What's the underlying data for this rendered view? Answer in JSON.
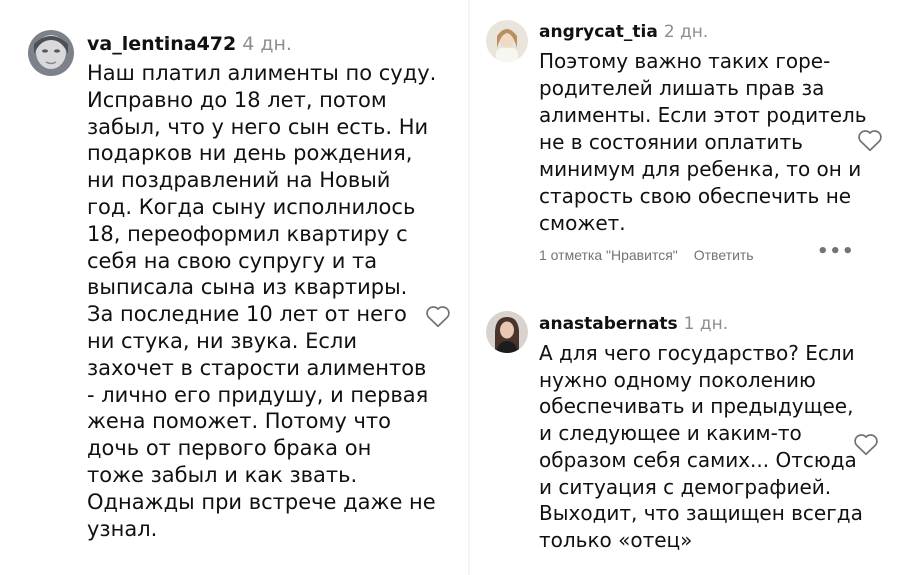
{
  "comments": [
    {
      "username": "va_lentina472",
      "time": "4 дн.",
      "text": "Наш платил алименты по суду.\nИсправно до 18 лет, потом\nзабыл, что у него сын есть. Ни\nподарков ни день рождения,\nни поздравлений на Новый\nгод. Когда сыну исполнилось\n18, переоформил квартиру с\nсебя на свою супругу и та\nвыписала сына из квартиры.\nЗа последние 10 лет от него\nни стука, ни звука. Если\nзахочет в старости алиментов\n- лично его придушу, и первая\nжена поможет. Потому что\nдочь от первого брака он\nтоже забыл и как звать.\nОднажды при встрече даже не\nузнал.",
      "like_icon": "heart-outline-icon"
    },
    {
      "username": "angrycat_tia",
      "time": "2 дн.",
      "text": "Поэтому важно таких горе-\nродителей лишать прав за\nалименты. Если этот родитель\nне в состоянии оплатить\nминимум для ребенка, то он и\nстарость свою обеспечить не\nсможет.",
      "likes_label": "1 отметка \"Нравится\"",
      "reply_label": "Ответить",
      "more_label": "•••",
      "like_icon": "heart-outline-icon"
    },
    {
      "username": "anastabernats",
      "time": "1 дн.",
      "text": "А для чего государство? Если\nнужно одному поколению\nобеспечивать и предыдущее,\nи следующее и каким-то\nобразом себя самих... Отсюда\nи ситуация с демографией.\nВыходит, что защищен всегда\nтолько «отец»",
      "like_icon": "heart-outline-icon"
    }
  ]
}
